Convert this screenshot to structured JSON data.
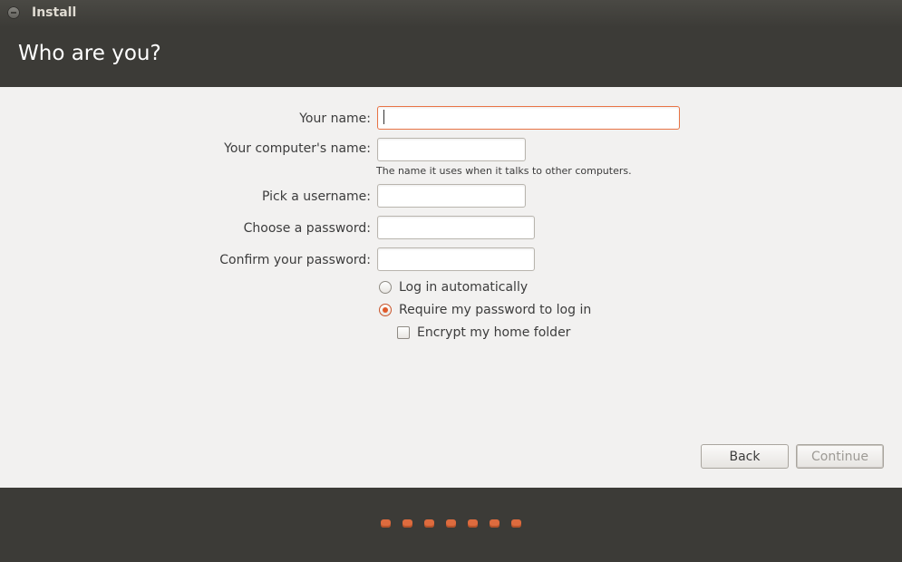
{
  "window": {
    "title": "Install"
  },
  "header": {
    "title": "Who are you?"
  },
  "form": {
    "name_label": "Your name:",
    "name_value": "",
    "computer_label": "Your computer's name:",
    "computer_value": "",
    "computer_hint": "The name it uses when it talks to other computers.",
    "username_label": "Pick a username:",
    "username_value": "",
    "password_label": "Choose a password:",
    "password_value": "",
    "confirm_label": "Confirm your password:",
    "confirm_value": ""
  },
  "login_options": {
    "auto_label": "Log in automatically",
    "auto_selected": false,
    "require_label": "Require my password to log in",
    "require_selected": true,
    "encrypt_label": "Encrypt my home folder",
    "encrypt_checked": false
  },
  "buttons": {
    "back": "Back",
    "continue": "Continue",
    "continue_enabled": false
  },
  "progress": {
    "total_steps": 7
  },
  "colors": {
    "accent": "#dd4814",
    "header_bg": "#3c3b37",
    "content_bg": "#f2f1f0"
  }
}
